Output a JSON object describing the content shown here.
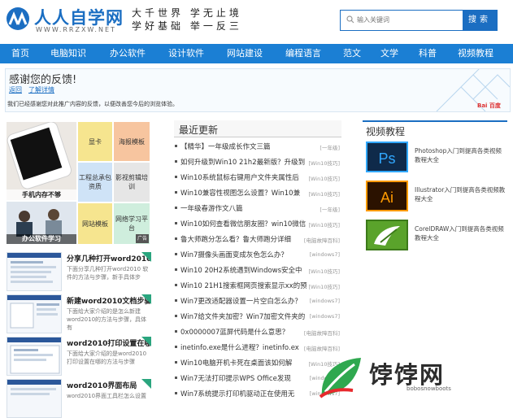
{
  "site": {
    "name": "人人自学网",
    "url": "WWW.RRZXW.NET",
    "slogan": [
      "大千世界  学无止境",
      "学好基础  举一反三"
    ]
  },
  "search": {
    "placeholder": "输入关键词",
    "button": "搜索"
  },
  "nav": [
    "首页",
    "电脑知识",
    "办公软件",
    "设计软件",
    "网站建设",
    "编程语言",
    "范文",
    "文学",
    "科普",
    "视频教程"
  ],
  "notice": {
    "title": "感谢您的反馈!",
    "back": "返回",
    "more": "了解详情",
    "desc": "我们已经感谢您对此推广内容的反馈，以便改善您今后的浏览体验。",
    "brand": "Bai 百度"
  },
  "grid": {
    "phone_caption": "手机内存不够",
    "office_caption": "办公软件学习",
    "ad": "广告",
    "tiles": [
      "显卡",
      "海报模板",
      "工程总承包资质",
      "影视剪辑培训",
      "网站模板",
      "网络学习平台"
    ]
  },
  "articles": [
    {
      "title": "分享几种打开word2010",
      "desc": "下面分享几种打开word2010 软件的方法与步骤，新手具体步"
    },
    {
      "title": "新建word2010文档步骤",
      "desc": "下面给大家介绍的是怎么新建 word2010的方法与步骤，具体有"
    },
    {
      "title": "word2010打印设置在哪",
      "desc": "下面给大家介绍的是word2010 打印设置在哪的方法与步骤"
    },
    {
      "title": "word2010界面布局",
      "desc": "word2010界面工具栏怎么设置"
    }
  ],
  "latest": {
    "heading": "最近更新",
    "items": [
      {
        "t": "【精华】一年级成长作文三篇",
        "c": "[一年级]"
      },
      {
        "t": "如何升级到Win10 21h2最新版？升级到",
        "c": "[Win10技巧]"
      },
      {
        "t": "Win10系统鼠标右键用户文件夹属性后",
        "c": "[Win10技巧]"
      },
      {
        "t": "Win10兼容性视图怎么设置？Win10兼",
        "c": "[Win10技巧]"
      },
      {
        "t": "一年级春游作文八篇",
        "c": "[一年级]"
      },
      {
        "t": "Win10如何查看微信朋友圈？win10微信",
        "c": "[Win10技巧]"
      },
      {
        "t": "鲁大师跑分怎么看？鲁大师跑分详细",
        "c": "[电脑故障百科]"
      },
      {
        "t": "Win7摄像头画面变成灰色怎么办？",
        "c": "[windows7]"
      },
      {
        "t": "Win10 20H2系统遇到Windows安全中",
        "c": "[Win10技巧]"
      },
      {
        "t": "Win10 21H1搜索框网页搜索显示xx的预",
        "c": "[Win10技巧]"
      },
      {
        "t": "Win7更改适配器设置一片空白怎么办？",
        "c": "[windows7]"
      },
      {
        "t": "Win7给文件夹加密？Win7加密文件夹的",
        "c": "[windows7]"
      },
      {
        "t": "0x0000007蓝屏代码是什么意思？",
        "c": "[电脑故障百科]"
      },
      {
        "t": "inetinfo.exe是什么进程？inetinfo.ex",
        "c": "[电脑故障百科]"
      },
      {
        "t": "Win10电脑开机卡死在桌面该如何解",
        "c": "[Win10技巧]"
      },
      {
        "t": "Win7无法打印提示WPS Office发现",
        "c": "[windows7]"
      },
      {
        "t": "Win7系统提示打印机驱动正在使用无",
        "c": "[windows7]"
      }
    ]
  },
  "video": {
    "heading": "视频教程",
    "items": [
      {
        "icon": "Ps",
        "text": "Photoshop入门到提高各类视频教程大全"
      },
      {
        "icon": "Ai",
        "text": "Illustrator入门到提高各类视频教程大全"
      },
      {
        "icon": "",
        "text": "CorelDRAW入门到提高各类视频教程大全"
      }
    ]
  },
  "watermark": {
    "name": "饽饽网",
    "url": "bobosnowboots"
  },
  "colors": {
    "brand": "#1b6ec2",
    "nav": "#1b7fd4",
    "ps": "#0f2a4a",
    "ai": "#2b1200",
    "cdr": "#5aa32b"
  }
}
